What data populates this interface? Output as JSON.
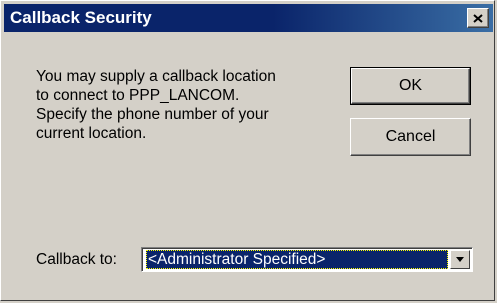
{
  "window": {
    "title": "Callback Security",
    "close_icon": "close-icon"
  },
  "message": {
    "lines": [
      "You may supply a callback location",
      "to connect to PPP_LANCOM.",
      "Specify the phone number of your",
      "current location."
    ]
  },
  "buttons": {
    "ok_label": "OK",
    "cancel_label": "Cancel"
  },
  "callback": {
    "label": "Callback to:",
    "selected_value": "<Administrator Specified>",
    "dropdown_icon": "chevron-down-icon"
  },
  "colors": {
    "titlebar": "#0a246a",
    "face": "#d4d0c8",
    "selection": "#0a246a"
  }
}
